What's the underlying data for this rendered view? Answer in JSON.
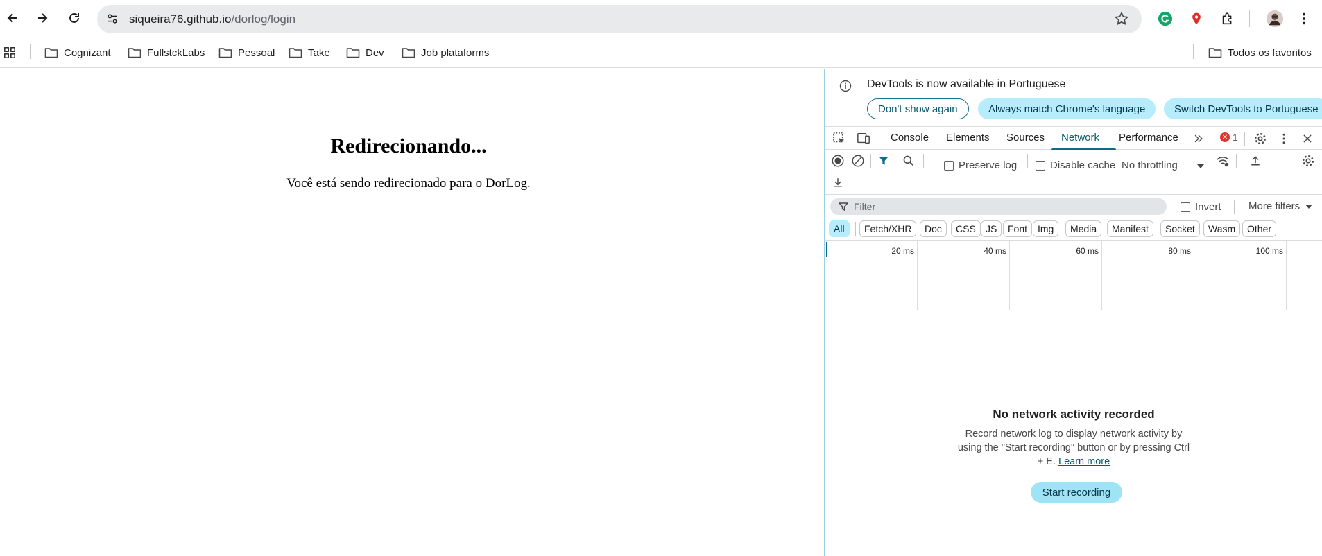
{
  "browser": {
    "url_host": "siqueira76.github.io",
    "url_path": "/dorlog/login",
    "icons": [
      "back-icon",
      "forward-icon",
      "reload-icon",
      "site-settings-icon",
      "star-icon",
      "grammarly-icon",
      "maps-pin-icon",
      "extensions-icon",
      "profile-avatar",
      "menu-icon"
    ]
  },
  "bookmarks": {
    "items": [
      {
        "label": "Cognizant"
      },
      {
        "label": "FullstckLabs"
      },
      {
        "label": "Pessoal"
      },
      {
        "label": "Take"
      },
      {
        "label": "Dev"
      },
      {
        "label": "Job plataforms"
      }
    ],
    "all_bookmarks": "Todos os favoritos"
  },
  "page": {
    "heading": "Redirecionando...",
    "text": "Você está sendo redirecionado para o DorLog."
  },
  "devtools": {
    "infobar": {
      "message": "DevTools is now available in Portuguese",
      "dont_show": "Don't show again",
      "always_match": "Always match Chrome's language",
      "switch": "Switch DevTools to Portuguese"
    },
    "tabs": [
      "Console",
      "Elements",
      "Sources",
      "Network",
      "Performance"
    ],
    "active_tab": "Network",
    "error_count": "1",
    "toolbar": {
      "preserve_log": "Preserve log",
      "disable_cache": "Disable cache",
      "throttling": "No throttling"
    },
    "filter": {
      "placeholder": "Filter",
      "invert": "Invert",
      "more_filters": "More filters"
    },
    "types": [
      "All",
      "Fetch/XHR",
      "Doc",
      "CSS",
      "JS",
      "Font",
      "Img",
      "Media",
      "Manifest",
      "Socket",
      "Wasm",
      "Other"
    ],
    "active_type": "All",
    "timeline_ticks": [
      "20 ms",
      "40 ms",
      "60 ms",
      "80 ms",
      "100 ms"
    ],
    "empty": {
      "title": "No network activity recorded",
      "desc_1": "Record network log to display network activity by using the \"Start recording\" button or by pressing Ctrl + E.",
      "learn_more": "Learn more",
      "start_button": "Start recording"
    }
  },
  "colors": {
    "accent": "#0b6e88",
    "chip_active": "#b6ecfb",
    "error": "#dc362e"
  }
}
